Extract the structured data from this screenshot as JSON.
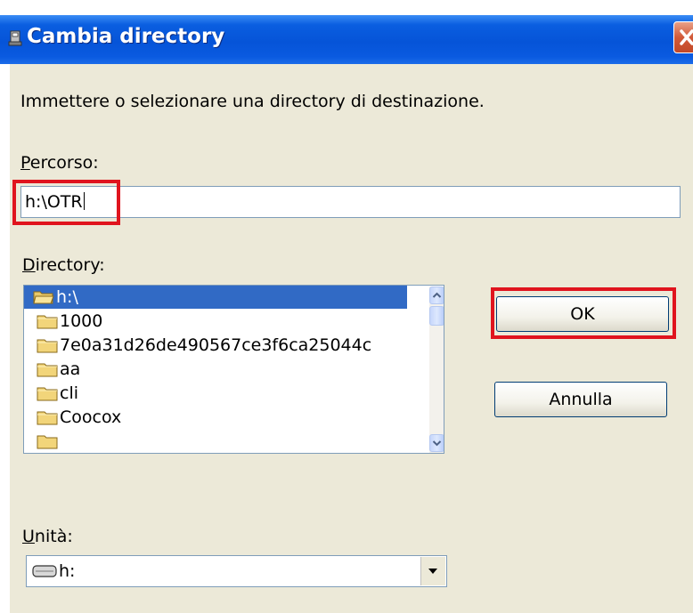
{
  "window": {
    "title": "Cambia directory",
    "accent_color": "#0a5ee0",
    "highlight_color": "#e0141e"
  },
  "instructions": "Immettere o selezionare una directory di destinazione.",
  "path": {
    "label_mnemonic": "P",
    "label_rest": "ercorso:",
    "value": "h:\\OTR"
  },
  "directory": {
    "label_mnemonic": "D",
    "label_rest": "irectory:",
    "items": [
      {
        "label": "h:\\",
        "icon": "open-folder-icon",
        "selected": true
      },
      {
        "label": "1000",
        "icon": "folder-icon",
        "selected": false
      },
      {
        "label": "7e0a31d26de490567ce3f6ca25044c",
        "icon": "folder-icon",
        "selected": false
      },
      {
        "label": "aa",
        "icon": "folder-icon",
        "selected": false
      },
      {
        "label": "cli",
        "icon": "folder-icon",
        "selected": false
      },
      {
        "label": "Coocox",
        "icon": "folder-icon",
        "selected": false
      }
    ]
  },
  "buttons": {
    "ok": "OK",
    "cancel": "Annulla"
  },
  "drive": {
    "label_mnemonic": "U",
    "label_rest": "nità:",
    "selected": "h:",
    "icon": "drive-icon"
  }
}
